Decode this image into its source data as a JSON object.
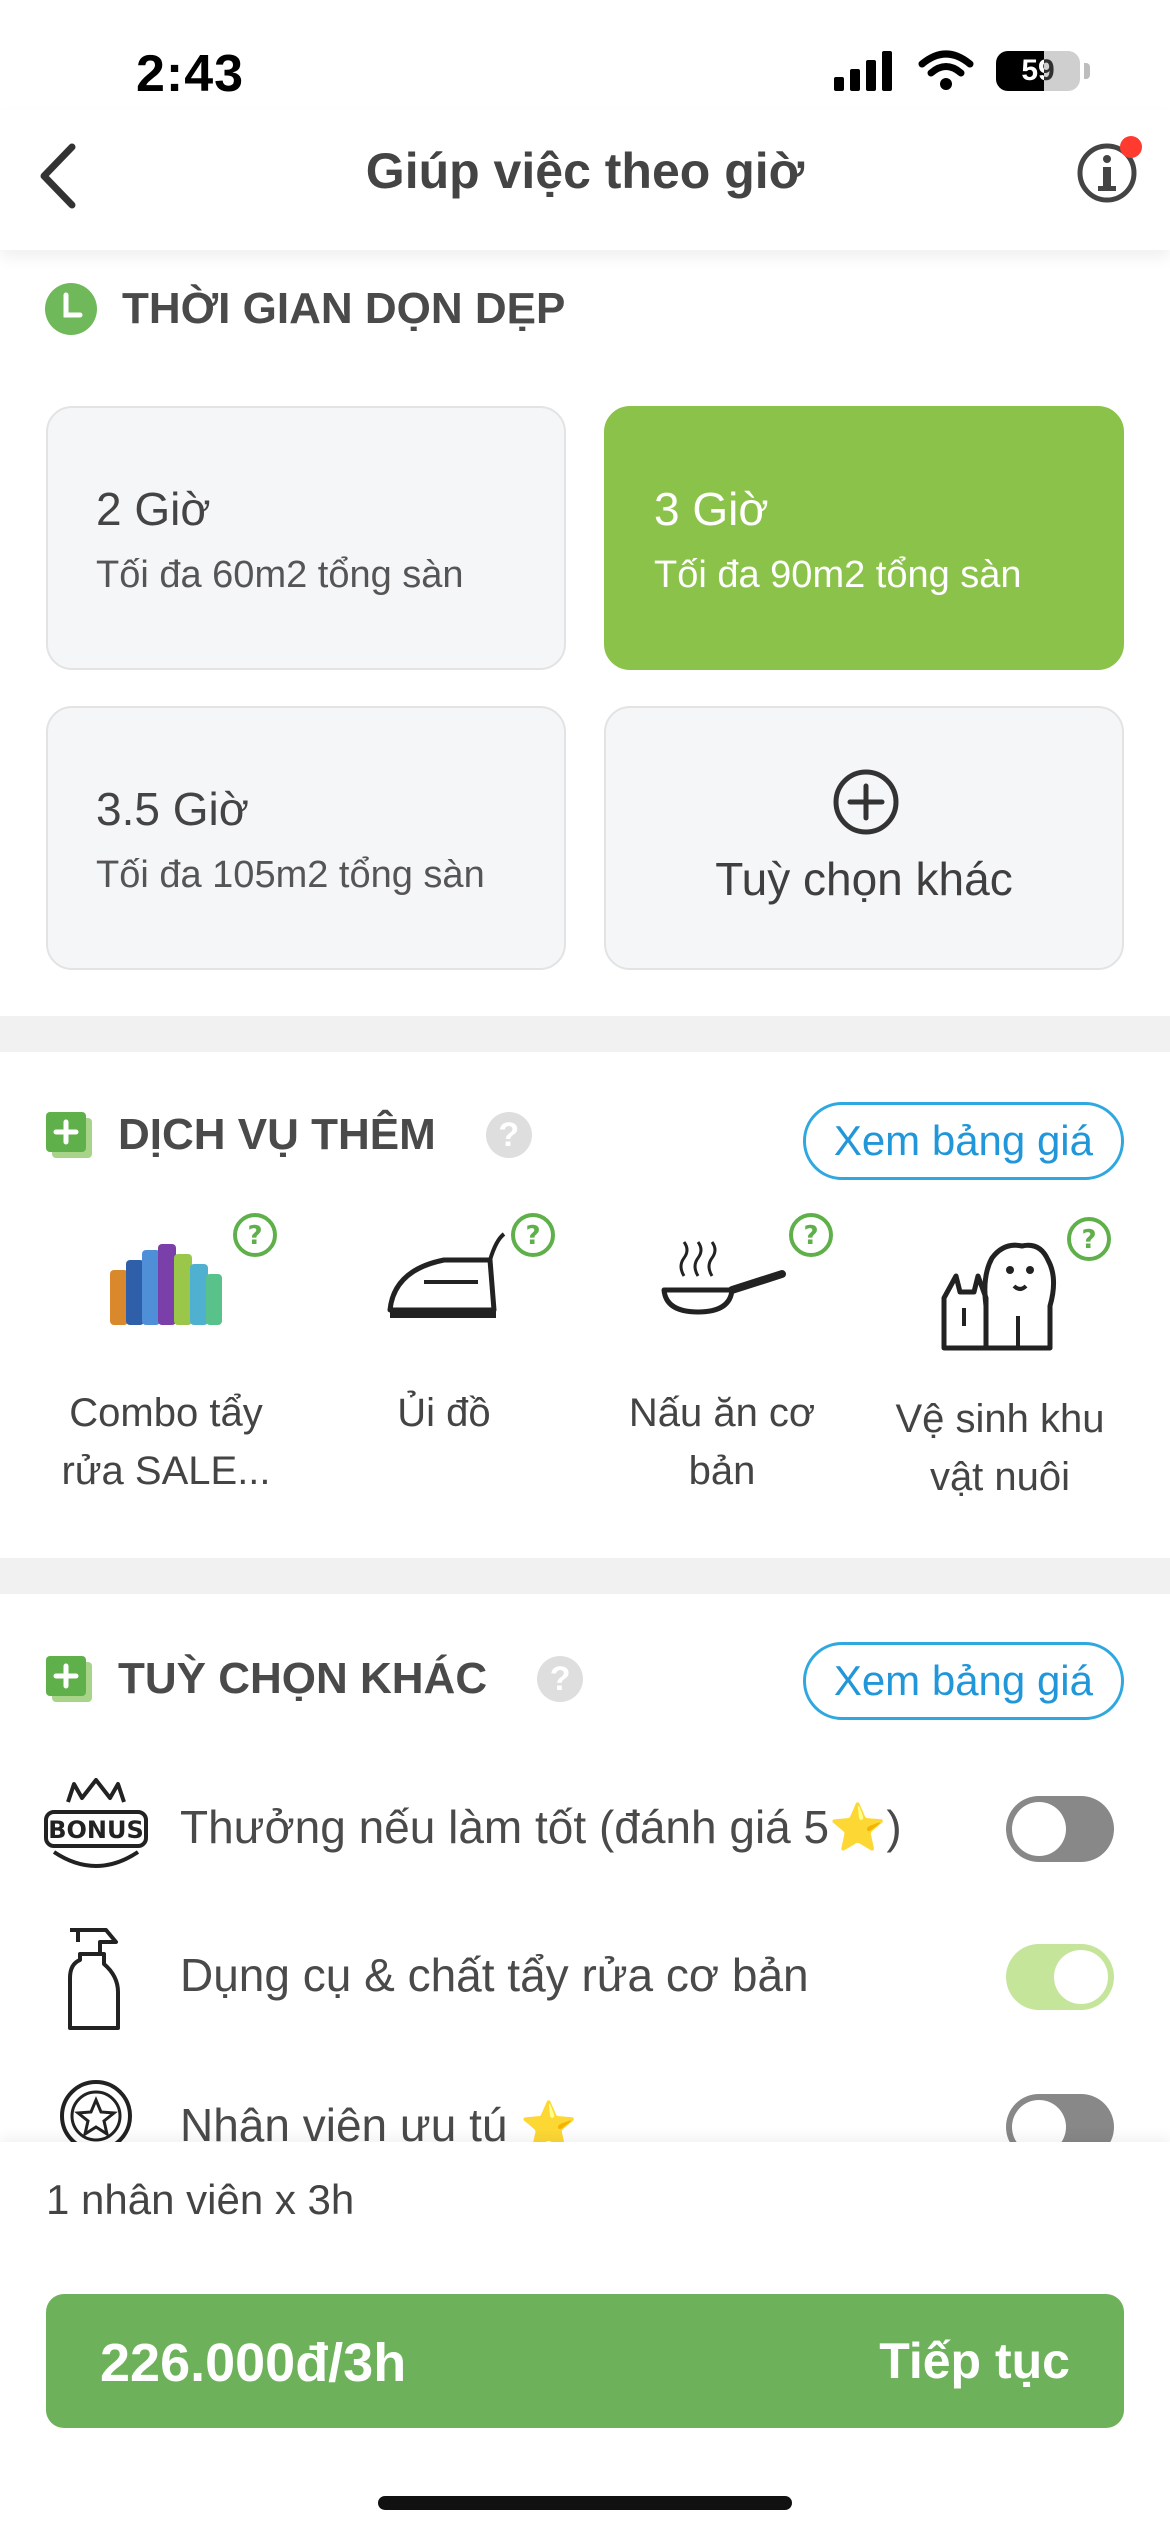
{
  "status_bar": {
    "time": "2:43",
    "battery": "59"
  },
  "header": {
    "title": "Giúp việc theo giờ"
  },
  "duration_section": {
    "title": "THỜI GIAN DỌN DẸP",
    "options": [
      {
        "hours": "2 Giờ",
        "desc": "Tối đa 60m2 tổng sàn",
        "selected": false
      },
      {
        "hours": "3 Giờ",
        "desc": "Tối đa 90m2 tổng sàn",
        "selected": true
      },
      {
        "hours": "3.5 Giờ",
        "desc": "Tối đa 105m2 tổng sàn",
        "selected": false
      }
    ],
    "other_label": "Tuỳ chọn khác"
  },
  "extra_section": {
    "title": "DỊCH VỤ THÊM",
    "price_link": "Xem bảng giá",
    "services": [
      {
        "label": "Combo tẩy rửa SALE...",
        "icon": "cleaning-products-icon"
      },
      {
        "label": "Ủi đồ",
        "icon": "iron-icon"
      },
      {
        "label": "Nấu ăn cơ bản",
        "icon": "frying-pan-icon"
      },
      {
        "label": "Vệ sinh khu vật nuôi",
        "icon": "pets-icon"
      }
    ]
  },
  "options_section": {
    "title": "TUỲ CHỌN KHÁC",
    "price_link": "Xem bảng giá",
    "items": [
      {
        "label": "Thưởng nếu làm tốt (đánh giá 5⭐)",
        "icon": "bonus-icon",
        "enabled": false
      },
      {
        "label": "Dụng cụ & chất tẩy rửa cơ bản",
        "icon": "spray-bottle-icon",
        "enabled": true
      },
      {
        "label": "Nhân viên ưu tú ⭐",
        "icon": "badge-icon",
        "enabled": false
      }
    ]
  },
  "footer": {
    "summary": "1 nhân viên x 3h",
    "price": "226.000đ/3h",
    "cta": "Tiếp tục"
  },
  "colors": {
    "accent_green": "#8bc34a",
    "button_green": "#6db25a",
    "link_blue": "#2196d9"
  }
}
